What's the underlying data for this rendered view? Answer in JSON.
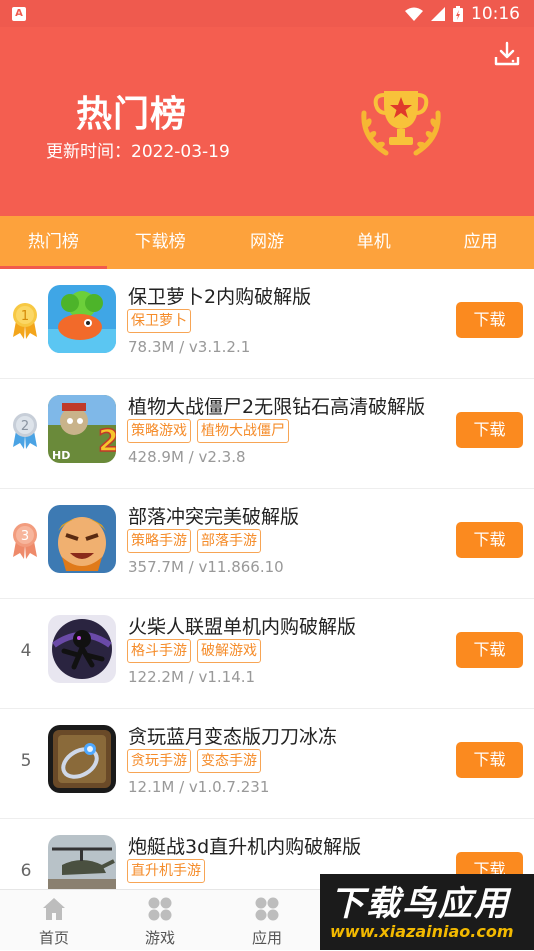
{
  "status_bar": {
    "time": "10:16",
    "app_badge": "A"
  },
  "hero": {
    "title": "热门榜",
    "updated": "更新时间：2022-03-19"
  },
  "tabs": [
    {
      "label": "热门榜",
      "active": true
    },
    {
      "label": "下载榜"
    },
    {
      "label": "网游"
    },
    {
      "label": "单机"
    },
    {
      "label": "应用"
    }
  ],
  "apps": [
    {
      "rank": "1",
      "name": "保卫萝卜2内购破解版",
      "tags": [
        "保卫萝卜"
      ],
      "meta": "78.3M / v3.1.2.1",
      "button": "下载"
    },
    {
      "rank": "2",
      "name": "植物大战僵尸2无限钻石高清破解版",
      "tags": [
        "策略游戏",
        "植物大战僵尸"
      ],
      "meta": "428.9M / v2.3.8",
      "button": "下载"
    },
    {
      "rank": "3",
      "name": "部落冲突完美破解版",
      "tags": [
        "策略手游",
        "部落手游"
      ],
      "meta": "357.7M / v11.866.10",
      "button": "下载"
    },
    {
      "rank": "4",
      "name": "火柴人联盟单机内购破解版",
      "tags": [
        "格斗手游",
        "破解游戏"
      ],
      "meta": "122.2M / v1.14.1",
      "button": "下载"
    },
    {
      "rank": "5",
      "name": "贪玩蓝月变态版刀刀冰冻",
      "tags": [
        "贪玩手游",
        "变态手游"
      ],
      "meta": "12.1M / v1.0.7.231",
      "button": "下载"
    },
    {
      "rank": "6",
      "name": "炮艇战3d直升机内购破解版",
      "tags": [
        "直升机手游"
      ],
      "meta": "",
      "button": "下载"
    }
  ],
  "bottom_nav": [
    {
      "label": "首页",
      "icon": "home-icon"
    },
    {
      "label": "游戏",
      "icon": "grid-icon"
    },
    {
      "label": "应用",
      "icon": "apps-icon"
    }
  ],
  "watermark": {
    "line1": "下载鸟应用",
    "line2": "www.xiazainiao.com"
  },
  "colors": {
    "hero": "#f45e50",
    "tabs": "#fda23c",
    "button": "#fb8a1f",
    "tag": "#f58c2a"
  }
}
